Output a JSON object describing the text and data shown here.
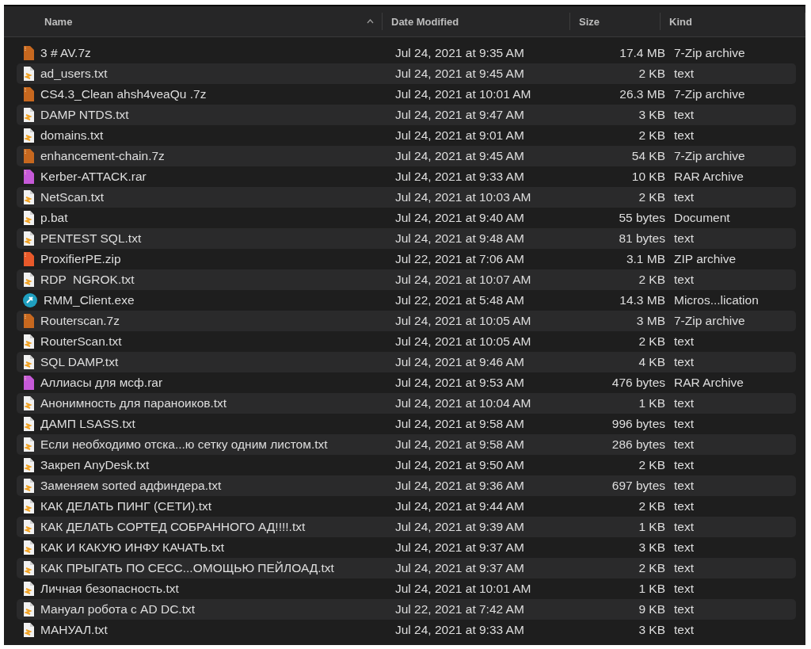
{
  "columns": [
    "Name",
    "Date Modified",
    "Size",
    "Kind"
  ],
  "files": [
    {
      "name": "3 # AV.7z",
      "date": "Jul 24, 2021 at 9:35 AM",
      "size": "17.4 MB",
      "type": "7-Zip archive",
      "kind": "archive7z"
    },
    {
      "name": "ad_users.txt",
      "date": "Jul 24, 2021 at 9:45 AM",
      "size": "2 KB",
      "type": "text",
      "kind": "text"
    },
    {
      "name": "CS4.3_Clean ahsh4veaQu .7z",
      "date": "Jul 24, 2021 at 10:01 AM",
      "size": "26.3 MB",
      "type": "7-Zip archive",
      "kind": "archive7z"
    },
    {
      "name": "DAMP NTDS.txt",
      "date": "Jul 24, 2021 at 9:47 AM",
      "size": "3 KB",
      "type": "text",
      "kind": "text"
    },
    {
      "name": "domains.txt",
      "date": "Jul 24, 2021 at 9:01 AM",
      "size": "2 KB",
      "type": "text",
      "kind": "text"
    },
    {
      "name": "enhancement-chain.7z",
      "date": "Jul 24, 2021 at 9:45 AM",
      "size": "54 KB",
      "type": "7-Zip archive",
      "kind": "archive7z"
    },
    {
      "name": "Kerber-ATTACK.rar",
      "date": "Jul 24, 2021 at 9:33 AM",
      "size": "10 KB",
      "type": "RAR Archive",
      "kind": "rar"
    },
    {
      "name": "NetScan.txt",
      "date": "Jul 24, 2021 at 10:03 AM",
      "size": "2 KB",
      "type": "text",
      "kind": "text"
    },
    {
      "name": "p.bat",
      "date": "Jul 24, 2021 at 9:40 AM",
      "size": "55 bytes",
      "type": "Document",
      "kind": "text"
    },
    {
      "name": "PENTEST SQL.txt",
      "date": "Jul 24, 2021 at 9:48 AM",
      "size": "81 bytes",
      "type": "text",
      "kind": "text"
    },
    {
      "name": "ProxifierPE.zip",
      "date": "Jul 22, 2021 at 7:06 AM",
      "size": "3.1 MB",
      "type": "ZIP archive",
      "kind": "zip"
    },
    {
      "name": "RDP  NGROK.txt",
      "date": "Jul 24, 2021 at 10:07 AM",
      "size": "2 KB",
      "type": "text",
      "kind": "text"
    },
    {
      "name": "RMM_Client.exe",
      "date": "Jul 22, 2021 at 5:48 AM",
      "size": "14.3 MB",
      "type": "Micros...lication",
      "kind": "app"
    },
    {
      "name": "Routerscan.7z",
      "date": "Jul 24, 2021 at 10:05 AM",
      "size": "3 MB",
      "type": "7-Zip archive",
      "kind": "archive7z"
    },
    {
      "name": "RouterScan.txt",
      "date": "Jul 24, 2021 at 10:05 AM",
      "size": "2 KB",
      "type": "text",
      "kind": "text"
    },
    {
      "name": "SQL DAMP.txt",
      "date": "Jul 24, 2021 at 9:46 AM",
      "size": "4 KB",
      "type": "text",
      "kind": "text"
    },
    {
      "name": "Аллиасы для мсф.rar",
      "date": "Jul 24, 2021 at 9:53 AM",
      "size": "476 bytes",
      "type": "RAR Archive",
      "kind": "rar"
    },
    {
      "name": "Анонимность для параноиков.txt",
      "date": "Jul 24, 2021 at 10:04 AM",
      "size": "1 KB",
      "type": "text",
      "kind": "text"
    },
    {
      "name": "ДАМП LSASS.txt",
      "date": "Jul 24, 2021 at 9:58 AM",
      "size": "996 bytes",
      "type": "text",
      "kind": "text"
    },
    {
      "name": "Если необходимо отска...ю сетку одним листом.txt",
      "date": "Jul 24, 2021 at 9:58 AM",
      "size": "286 bytes",
      "type": "text",
      "kind": "text"
    },
    {
      "name": "Закреп AnyDesk.txt",
      "date": "Jul 24, 2021 at 9:50 AM",
      "size": "2 KB",
      "type": "text",
      "kind": "text"
    },
    {
      "name": "Заменяем sorted адфиндера.txt",
      "date": "Jul 24, 2021 at 9:36 AM",
      "size": "697 bytes",
      "type": "text",
      "kind": "text"
    },
    {
      "name": "КАК ДЕЛАТЬ ПИНГ (СЕТИ).txt",
      "date": "Jul 24, 2021 at 9:44 AM",
      "size": "2 KB",
      "type": "text",
      "kind": "text"
    },
    {
      "name": "КАК ДЕЛАТЬ СОРТЕД СОБРАННОГО АД!!!!.txt",
      "date": "Jul 24, 2021 at 9:39 AM",
      "size": "1 KB",
      "type": "text",
      "kind": "text"
    },
    {
      "name": "КАК И КАКУЮ ИНФУ КАЧАТЬ.txt",
      "date": "Jul 24, 2021 at 9:37 AM",
      "size": "3 KB",
      "type": "text",
      "kind": "text"
    },
    {
      "name": "КАК ПРЫГАТЬ ПО СЕСС...ОМОЩЬЮ ПЕЙЛОАД.txt",
      "date": "Jul 24, 2021 at 9:37 AM",
      "size": "2 KB",
      "type": "text",
      "kind": "text"
    },
    {
      "name": "Личная безопасность.txt",
      "date": "Jul 24, 2021 at 10:01 AM",
      "size": "1 KB",
      "type": "text",
      "kind": "text"
    },
    {
      "name": "Мануал робота с AD DC.txt",
      "date": "Jul 22, 2021 at 7:42 AM",
      "size": "9 KB",
      "type": "text",
      "kind": "text"
    },
    {
      "name": "МАНУАЛ.txt",
      "date": "Jul 24, 2021 at 9:33 AM",
      "size": "3 KB",
      "type": "text",
      "kind": "text"
    }
  ]
}
